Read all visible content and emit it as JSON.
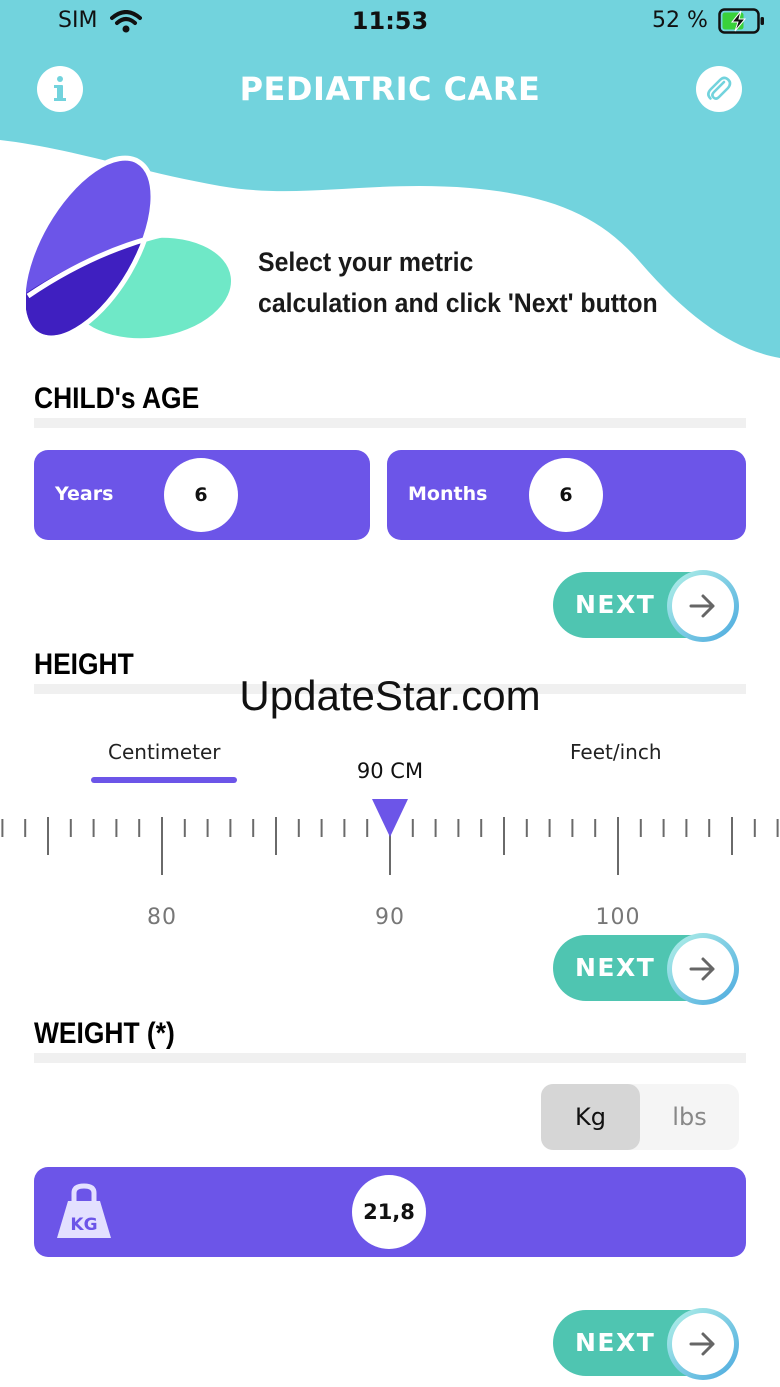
{
  "status_bar": {
    "carrier": "SIM",
    "time": "11:53",
    "battery_text": "52 %"
  },
  "header": {
    "title": "PEDIATRIC CARE",
    "info_icon": "info-icon",
    "attach_icon": "paperclip-icon"
  },
  "intro": {
    "line1": "Select your metric",
    "line2": "calculation and click 'Next' button"
  },
  "age": {
    "title": "CHILD's AGE",
    "years_label": "Years",
    "years_value": "6",
    "months_label": "Months",
    "months_value": "6",
    "next_label": "NEXT"
  },
  "height": {
    "title": "HEIGHT",
    "tab_cm": "Centimeter",
    "tab_ft": "Feet/inch",
    "readout": "90 CM",
    "ruler_labels": [
      "80",
      "90",
      "100"
    ],
    "selected_value": 90,
    "next_label": "NEXT"
  },
  "watermark": "UpdateStar.com",
  "weight": {
    "title": "WEIGHT (*)",
    "unit_kg": "Kg",
    "unit_lbs": "lbs",
    "icon_text": "KG",
    "value": "21,8",
    "next_label": "NEXT"
  },
  "colors": {
    "teal": "#72d3dd",
    "purple": "#6c55e8",
    "green": "#4fc5b1",
    "mint": "#6fe8c7",
    "dark_purple": "#3f1fc0"
  }
}
